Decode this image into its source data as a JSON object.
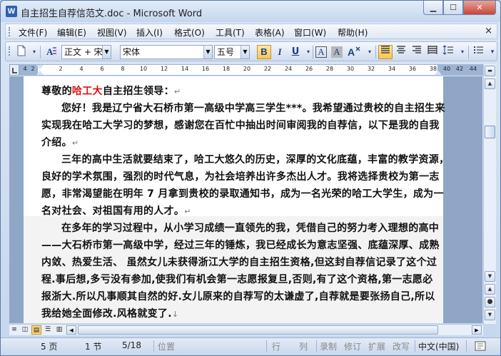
{
  "window": {
    "title": "自主招生自荐信范文.doc - Microsoft Word",
    "app_icon": "W",
    "controls": {
      "minimize": "▁",
      "maximize": "☐",
      "close": "✕"
    }
  },
  "menubar": {
    "items": [
      "文件(F)",
      "编辑(E)",
      "视图(V)",
      "插入(I)",
      "格式(O)",
      "工具(T)",
      "表格(A)",
      "窗口(W)",
      "帮助(H)"
    ],
    "doc_close": "×"
  },
  "toolbar": {
    "style_value": "正文 + 宋体",
    "font_value": "宋体",
    "size_value": "五号",
    "bold": "B",
    "italic": "I",
    "underline": "U",
    "char_border": "A",
    "char_shade": "A",
    "format_painter": "A"
  },
  "ruler": {
    "left_ticks": [
      "4",
      "2"
    ],
    "ticks": [
      "2",
      "4",
      "6",
      "8",
      "10",
      "12",
      "14",
      "16",
      "18",
      "20",
      "22",
      "24",
      "26",
      "28",
      "30",
      "32",
      "34",
      "36",
      "38"
    ],
    "right_ticks": [
      "40",
      "42",
      "44"
    ]
  },
  "document": {
    "paragraphs": [
      {
        "runs": [
          {
            "text": "尊敬的"
          },
          {
            "text": "哈工大",
            "color": "#e01010"
          },
          {
            "text": "自主招生领导："
          }
        ],
        "mark": "↵"
      },
      {
        "runs": [
          {
            "text": "您好！我是辽宁省大石桥市第一高级中学高三学生***。我希望通过贵校的自主招生来"
          }
        ]
      },
      {
        "runs": [
          {
            "text": "实现我在哈工大学习的梦想，感谢您在百忙中抽出时间审阅我的自荐信，以下是我的自我"
          }
        ]
      },
      {
        "runs": [
          {
            "text": "介绍。"
          }
        ],
        "mark": "↵"
      },
      {
        "runs": [
          {
            "text": "三年的高中生活就要结束了，哈工大悠久的历史，深厚的文化底蕴，丰富的教学资源，"
          }
        ]
      },
      {
        "runs": [
          {
            "text": "良好的学术氛围，强烈的时代气息，为社会培养出许多杰出人才。我将选择贵校为第一志"
          }
        ]
      },
      {
        "runs": [
          {
            "text": "愿，非常渴望能在明年 7 月拿到贵校的录取通知书，成为一名光荣的哈工大学生，成为一"
          }
        ]
      },
      {
        "runs": [
          {
            "text": "名对社会、对祖国有用的人才。"
          }
        ],
        "mark": "↵"
      },
      {
        "runs": [
          {
            "text": "在多年的学习过程中，从小学习成绩一直领先的我，凭借自己的努力考入理想的高中"
          }
        ]
      },
      {
        "runs": [
          {
            "text": "——大石桥市第一高级中学，经过三年的锤炼，我已经成长为意志坚强、底蕴深厚、成熟"
          }
        ]
      },
      {
        "runs": [
          {
            "text": "内敛、热爱生活、  虽然女儿未获得浙江大学的自主招生资格,但这封自荐信记录了这个过"
          }
        ]
      },
      {
        "runs": [
          {
            "text": "程.事后想,多亏没有参加,使我们有机会第一志愿报复旦,否则,有了这个资格,第一志愿必"
          }
        ]
      },
      {
        "runs": [
          {
            "text": "报浙大.所以凡事顺其自然的好.女儿原来的自荐写的太谦虚了,自荐就是要张扬自己,所以"
          }
        ]
      },
      {
        "runs": [
          {
            "text": "我给她全面修改.风格就变了."
          }
        ],
        "mark": "↓"
      }
    ]
  },
  "statusbar": {
    "page": "5 页",
    "section": "1 节",
    "pages": "5/18",
    "position": "位置",
    "line": "行",
    "column": "列",
    "record": "录制",
    "revise": "修订",
    "extend": "扩展",
    "overtype": "改写",
    "language": "中文(中国)"
  }
}
